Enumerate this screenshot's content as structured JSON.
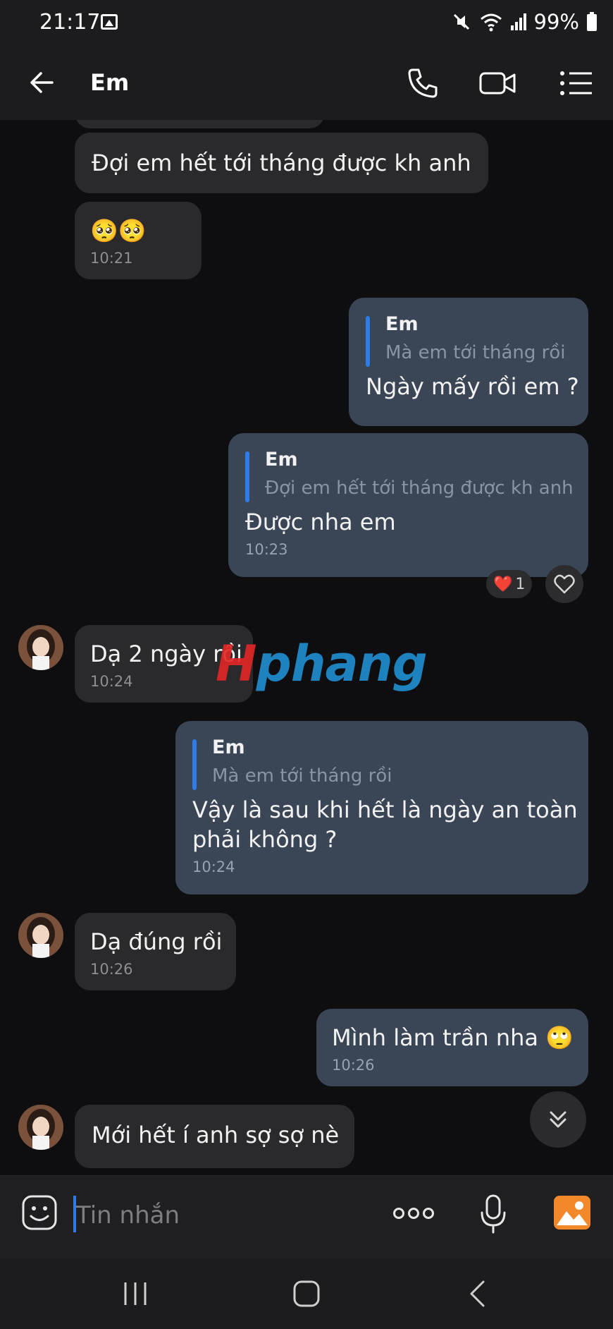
{
  "status": {
    "time": "21:17",
    "battery": "99%"
  },
  "header": {
    "contact_name": "Em"
  },
  "messages": {
    "m1": {
      "text": "Đợi em hết tới tháng được kh anh"
    },
    "m2": {
      "text": "🥺🥺",
      "time": "10:21"
    },
    "m3": {
      "quote_name": "Em",
      "quote_text": "Mà em tới tháng rồi",
      "text": "Ngày mấy rồi em ?"
    },
    "m4": {
      "quote_name": "Em",
      "quote_text": "Đợi em hết tới tháng được kh anh",
      "text": "Được nha em",
      "time": "10:23",
      "reaction_emoji": "❤️",
      "reaction_count": "1"
    },
    "m5": {
      "text": "Dạ 2 ngày rồi",
      "time": "10:24"
    },
    "m6": {
      "quote_name": "Em",
      "quote_text": "Mà em tới tháng rồi",
      "line1": "Vậy là sau khi hết là ngày an toàn",
      "line2": "phải không ?",
      "time": "10:24"
    },
    "m7": {
      "text": "Dạ đúng rồi",
      "time": "10:26"
    },
    "m8": {
      "text": "Mình làm trần nha 🙄",
      "time": "10:26"
    },
    "m9": {
      "text": "Mới hết í anh sợ sợ nè"
    }
  },
  "watermark": {
    "lead": "H",
    "rest": "phang"
  },
  "composer": {
    "placeholder": "Tin nhắn"
  },
  "colors": {
    "incoming_bubble": "#2a2a2d",
    "outgoing_bubble": "#3a4656",
    "accent": "#2f7be8",
    "background": "#0e0e10"
  }
}
